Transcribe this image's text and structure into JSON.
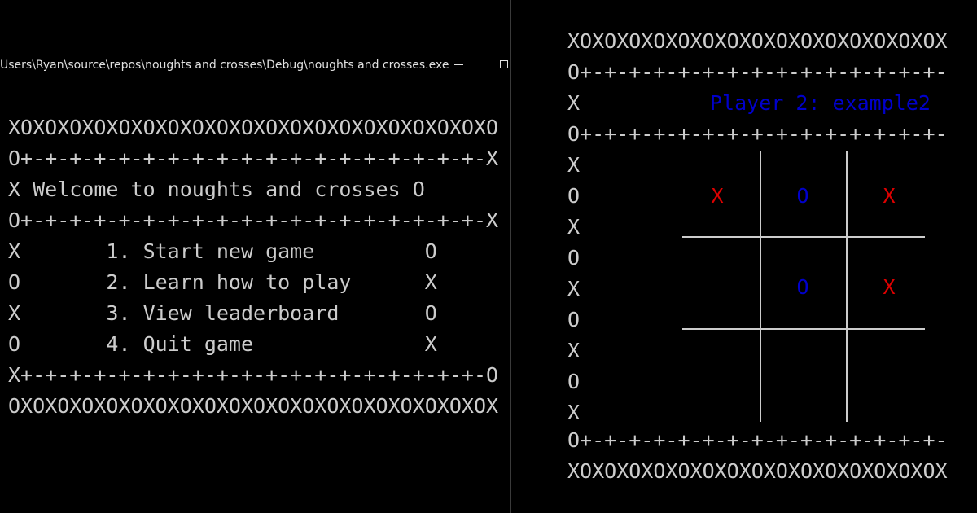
{
  "left_window": {
    "title": "Users\\Ryan\\source\\repos\\noughts and crosses\\Debug\\noughts and crosses.exe",
    "lines": [
      "XOXOXOXOXOXOXOXOXOXOXOXOXOXOXOXOXOXOXOXO",
      "O+-+-+-+-+-+-+-+-+-+-+-+-+-+-+-+-+-+-+-X",
      "X Welcome to noughts and crosses O",
      "O+-+-+-+-+-+-+-+-+-+-+-+-+-+-+-+-+-+-+-X",
      "X       1. Start new game         O",
      "O       2. Learn how to play      X",
      "X       3. View leaderboard       O",
      "O       4. Quit game              X",
      "X+-+-+-+-+-+-+-+-+-+-+-+-+-+-+-+-+-+-+-O",
      "OXOXOXOXOXOXOXOXOXOXOXOXOXOXOXOXOXOXOXOX"
    ]
  },
  "right_window": {
    "top_border": "XOXOXOXOXOXOXOXOXOXOXOXOXOXOXOX",
    "dash_border_1": "O+-+-+-+-+-+-+-+-+-+-+-+-+-+-+-",
    "player_row_prefix": "X",
    "player_label": "Player 2: example2",
    "dash_border_2": "O+-+-+-+-+-+-+-+-+-+-+-+-+-+-+-",
    "side_column": [
      "X",
      "O",
      "X",
      "O",
      "X",
      "O",
      "X",
      "O",
      "X"
    ],
    "dash_border_3": "O+-+-+-+-+-+-+-+-+-+-+-+-+-+-+-",
    "bottom_border": "XOXOXOXOXOXOXOXOXOXOXOXOXOXOXOX",
    "board": [
      [
        "X",
        "O",
        "X"
      ],
      [
        "",
        "O",
        "X"
      ],
      [
        "",
        "",
        ""
      ]
    ],
    "colors": {
      "x_mark": "#dd0000",
      "o_mark": "#0000cc",
      "player_label": "#0000cc"
    }
  }
}
